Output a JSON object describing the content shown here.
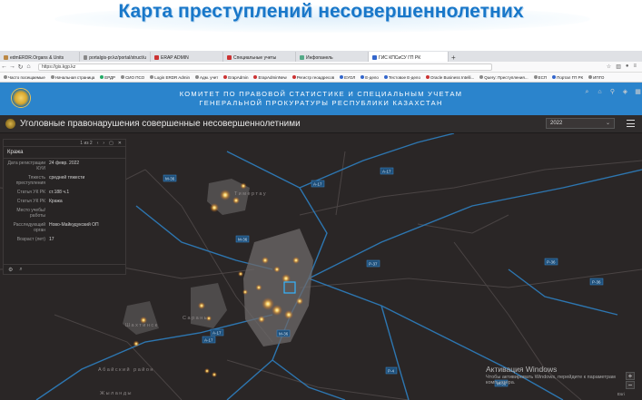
{
  "slide_title": "Карта преступлений несовершеннолетних",
  "browser": {
    "tabs": [
      {
        "label": "edmERDR.Organs & Units",
        "active": false
      },
      {
        "label": "portalgis-pr.kz/portal/struct/u",
        "active": false
      },
      {
        "label": "ERAP ADMIN",
        "active": false
      },
      {
        "label": "Специальные учеты",
        "active": false
      },
      {
        "label": "Инфопанель",
        "active": false
      },
      {
        "label": "ГИС КПСиСУ ГП РК",
        "active": true
      }
    ],
    "new_tab": "+",
    "url": "https://gis.kgp.kz",
    "bookmarks": [
      "Часто посещаемые",
      "Начальная страница",
      "ЕРДР",
      "СИО ПСО",
      "Login ERDR Admin",
      "Адм. учет",
      "ErapAdmin",
      "ErapAdminNew",
      "Регистр геоадресов",
      "ЕУОЛ",
      "Е-дело",
      "Тестовое Е-дело",
      "Oracle Business Intelli...",
      "Query: Преступления...",
      "ЕСП",
      "Портал ГП РК",
      "ИПГО"
    ]
  },
  "banner": {
    "line1": "КОМИТЕТ ПО ПРАВОВОЙ СТАТИСТИКЕ И СПЕЦИАЛЬНЫМ УЧЕТАМ",
    "line2": "ГЕНЕРАЛЬНОЙ ПРОКУРАТУРЫ РЕСПУБЛИКИ КАЗАХСТАН"
  },
  "app": {
    "title": "Уголовные правонарушения совершенные несовершеннолетними",
    "year": "2022"
  },
  "popup": {
    "counter": "1 из 2",
    "title": "Кража",
    "fields": [
      {
        "key": "Дата регистрации КУИ",
        "value": "24 февр. 2022"
      },
      {
        "key": "Тяжесть преступления",
        "value": "средней тяжести"
      },
      {
        "key": "Статья УК РК",
        "value": "ст.188 ч.1"
      },
      {
        "key": "Статья УК РК",
        "value": "Кража"
      },
      {
        "key": "Место учебы/работы",
        "value": ""
      },
      {
        "key": "Расследующий орган",
        "value": "Ново-Майкудукский ОП"
      },
      {
        "key": "Возраст (лет)",
        "value": "17"
      }
    ]
  },
  "map": {
    "place_labels": [
      "Тимертау",
      "Сарань",
      "Шахтинск",
      "Абайский район",
      "Жыланды"
    ],
    "road_labels": [
      "A-17",
      "M-36",
      "A-17",
      "P-37",
      "A-17",
      "M-36",
      "P-4",
      "M-36",
      "P-36",
      "A-17",
      "P-36",
      "M-36"
    ]
  },
  "windows_notice": {
    "title": "Активация Windows",
    "text": "Чтобы активировать Windows, перейдите к параметрам компьютера."
  },
  "attribution": "Esri"
}
